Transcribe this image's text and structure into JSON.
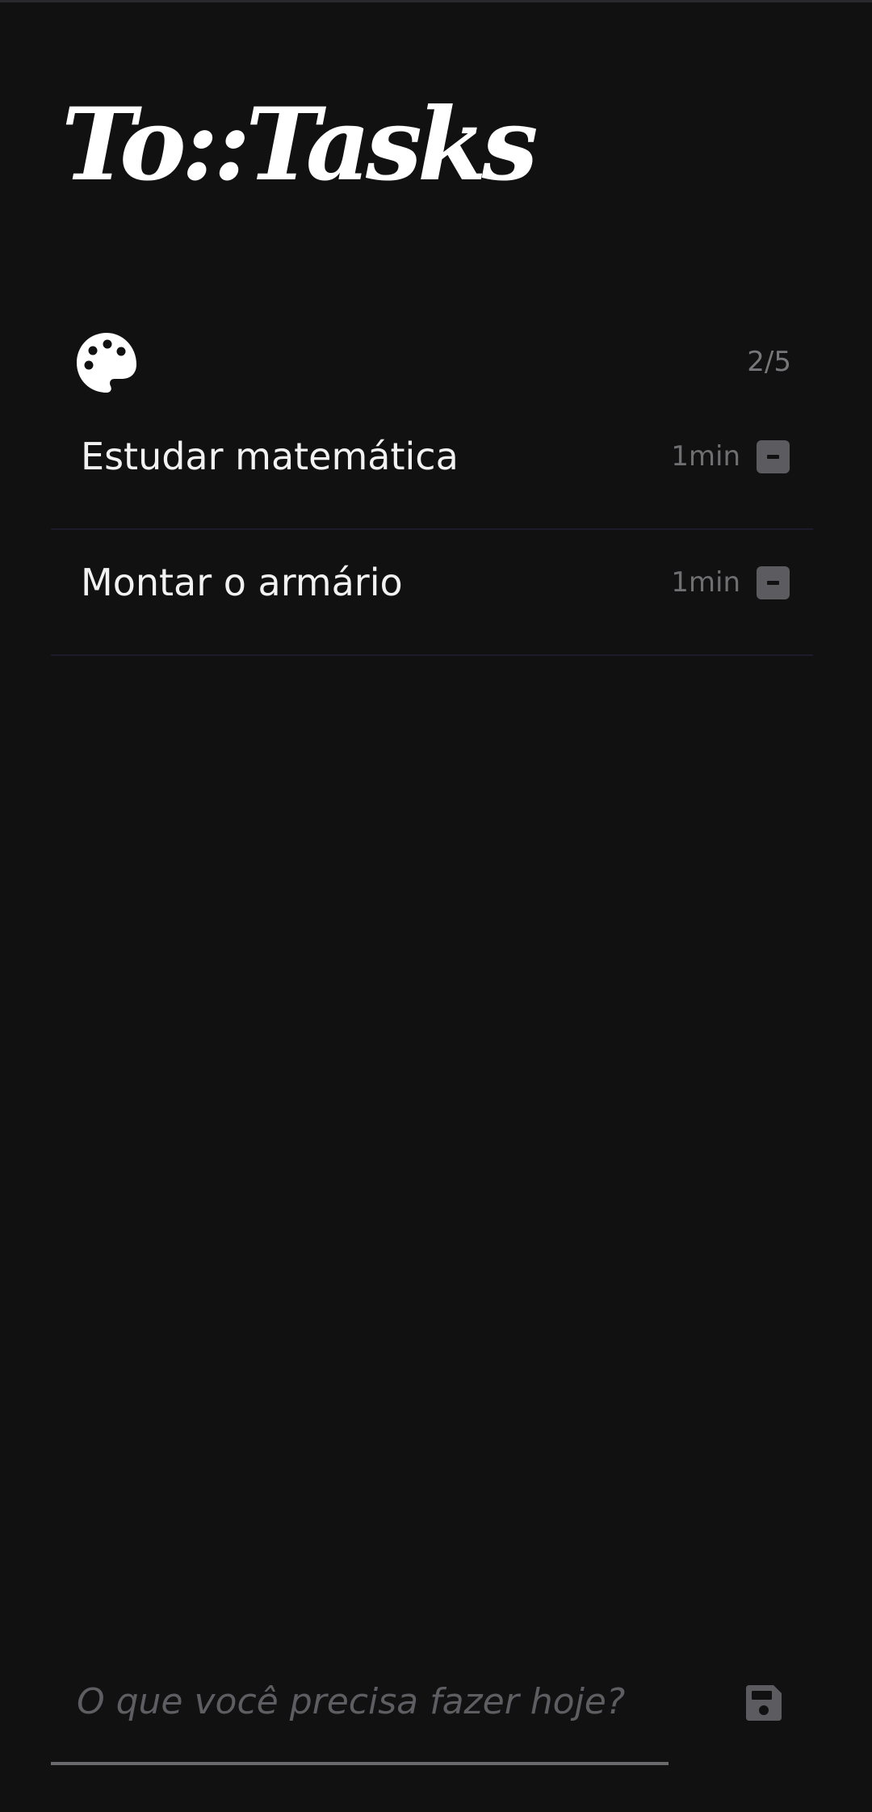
{
  "app": {
    "logo": "To::Tasks"
  },
  "list": {
    "icon": "palette-icon",
    "counter": "2/5",
    "items": [
      {
        "label": "Estudar matemática",
        "time": "1min",
        "action_icon": "minus-square-icon"
      },
      {
        "label": "Montar o armário",
        "time": "1min",
        "action_icon": "minus-square-icon"
      }
    ]
  },
  "composer": {
    "placeholder": "O que você precisa fazer hoje?",
    "value": "",
    "save_icon": "floppy-disk-icon"
  },
  "colors": {
    "background": "#111112",
    "text": "#f2f2f2",
    "muted": "#6f6f72",
    "button": "#5c5c60",
    "divider": "#1d1b29"
  }
}
